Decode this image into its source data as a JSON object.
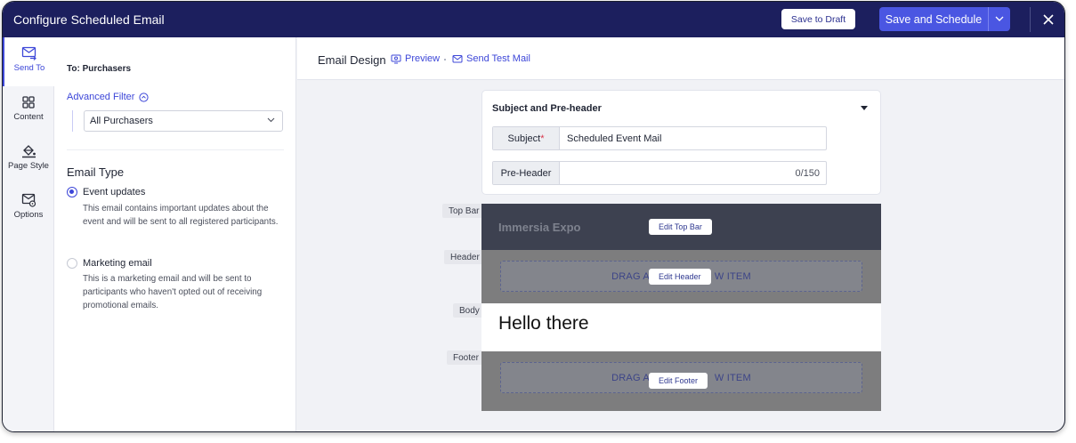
{
  "window": {
    "title": "Configure Scheduled Email"
  },
  "toolbar": {
    "save_draft_label": "Save to Draft",
    "save_schedule_label": "Save and Schedule"
  },
  "rail": {
    "items": [
      {
        "label": "Send To",
        "icon": "mail-forward-icon",
        "active": true
      },
      {
        "label": "Content",
        "icon": "grid-icon",
        "active": false
      },
      {
        "label": "Page Style",
        "icon": "paint-bucket-icon",
        "active": false
      },
      {
        "label": "Options",
        "icon": "mail-settings-icon",
        "active": false
      }
    ]
  },
  "panel": {
    "to_label": "To: Purchasers",
    "advanced_filter_label": "Advanced Filter",
    "filter_value": "All Purchasers",
    "email_type_heading": "Email Type",
    "options": [
      {
        "label": "Event updates",
        "selected": true,
        "description": "This email contains important updates about the event and will be sent to all registered participants."
      },
      {
        "label": "Marketing email",
        "selected": false,
        "description": "This is a marketing email and will be sent to participants who haven't opted out of receiving promotional emails."
      }
    ]
  },
  "main": {
    "title": "Email Design",
    "preview_label": "Preview",
    "send_test_label": "Send Test Mail"
  },
  "subject_card": {
    "heading": "Subject and Pre-header",
    "subject_label": "Subject",
    "required_mark": "*",
    "subject_value": "Scheduled Event Mail",
    "preheader_label": "Pre-Header",
    "preheader_counter": "0/150"
  },
  "email": {
    "sections": {
      "top_bar": "Top Bar",
      "header": "Header",
      "body": "Body",
      "footer": "Footer"
    },
    "brand": "Immersia Expo",
    "edit_top_bar": "Edit Top Bar",
    "edit_header": "Edit Header",
    "edit_footer": "Edit Footer",
    "header_drop_left": "DRAG A",
    "header_drop_right": "W ITEM",
    "footer_drop_left": "DRAG A",
    "footer_drop_right": "W ITEM",
    "body_text": "Hello there"
  },
  "colors": {
    "title_bar": "#1c1f5e",
    "accent": "#4a56e2",
    "link": "#3d47d8"
  }
}
